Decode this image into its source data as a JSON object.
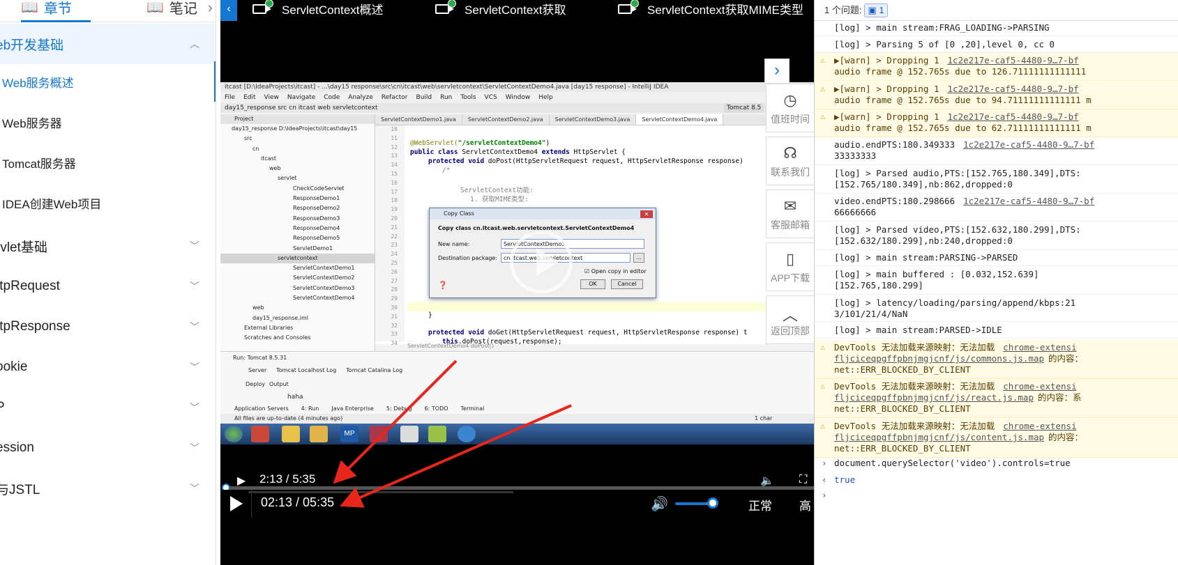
{
  "sidebar": {
    "tab_chapters": "章节",
    "tab_notes": "笔记",
    "chapters": [
      {
        "label": "eb开发基础",
        "active": true
      },
      {
        "label": "rvlet基础"
      },
      {
        "label": "ttpRequest"
      },
      {
        "label": "ttpResponse"
      },
      {
        "label": "ookie"
      },
      {
        "label": "P"
      },
      {
        "label": "ession"
      },
      {
        "label": "与JSTL"
      }
    ],
    "sections": [
      {
        "label": "Web服务概述",
        "active": true
      },
      {
        "label": "Web服务器"
      },
      {
        "label": "Tomcat服务器"
      },
      {
        "label": "IDEA创建Web项目"
      }
    ]
  },
  "video": {
    "titles": [
      "ServletContext概述",
      "ServletContext获取",
      "ServletContext获取MIME类型"
    ],
    "native_time": "2:13 / 5:35",
    "player_time": "02:13 / 05:35",
    "progress": 0.397,
    "volume": 0.75,
    "speed": "正常",
    "quality": "高"
  },
  "side_tools": [
    {
      "label": "值班时间",
      "icon": "clock-icon"
    },
    {
      "label": "联系我们",
      "icon": "headset-icon"
    },
    {
      "label": "客服邮箱",
      "icon": "mail-icon"
    },
    {
      "label": "APP下载",
      "icon": "phone-icon"
    },
    {
      "label": "返回顶部",
      "icon": "chevron-up-icon"
    }
  ],
  "ide": {
    "title": "itcast [D:\\IdeaProjects\\itcast] - ...\\day15 response\\src\\cn\\itcast\\web\\servletcontext\\ServletContextDemo4.java [day15 response] - IntelliJ IDEA",
    "menu": [
      "File",
      "Edit",
      "View",
      "Navigate",
      "Code",
      "Analyze",
      "Refactor",
      "Build",
      "Run",
      "Tools",
      "VCS",
      "Window",
      "Help"
    ],
    "crumb": "day15_response  src  cn  itcast  web  servletcontext",
    "project_label": "Project",
    "tree": [
      "day15_response  D:\\IdeaProjects\\itcast\\day15",
      "src",
      "cn",
      "itcast",
      "web",
      "servlet",
      "CheckCodeServlet",
      "ResponseDemo1",
      "ResponseDemo2",
      "ResponseDemo3",
      "ResponseDemo4",
      "ResponseDemo5",
      "ServletDemo1",
      "servletcontext",
      "ServletContextDemo1",
      "ServletContextDemo2",
      "ServletContextDemo3",
      "ServletContextDemo4",
      "web",
      "day15_response.iml",
      "External Libraries",
      "Scratches and Consoles"
    ],
    "editor_tabs": [
      "ServletContextDemo1.java",
      "ServletContextDemo2.java",
      "ServletContextDemo3.java",
      "ServletContextDemo4.java"
    ],
    "line_numbers": [
      "10",
      "11",
      "12",
      "13",
      "14",
      "15",
      "16",
      "17",
      "18",
      "19",
      "20",
      "21",
      "22",
      "23",
      "24",
      "25",
      "26",
      "27",
      "28",
      "29",
      "30",
      "31",
      "32",
      "33",
      "34"
    ],
    "code": {
      "l1_ann": "@WebServlet(",
      "l1_str": "\"/servletContextDemo4\"",
      "l1_end": ")",
      "l2_kw1": "public class",
      "l2_mid": " ServletContextDemo4 ",
      "l2_kw2": "extends",
      "l2_end": " HttpServlet {",
      "l3_kw": "protected void",
      "l3_end": " doPost(HttpServletRequest request, HttpServletResponse response)",
      "l4": "/*",
      "l5": "ServletContext功能:",
      "l6": "1. 获取MIME类型:",
      "l7": "}",
      "l8_kw": "protected void",
      "l8_end": " doGet(HttpServletRequest request, HttpServletResponse response) t",
      "l9_kw": "this",
      "l9_end": ".doPost(request,response);",
      "footer": "ServletContextDemo4  doPost()"
    },
    "dialog": {
      "title": "Copy Class",
      "heading": "Copy class cn.itcast.web.servletcontext.ServletContextDemo4",
      "new_name_label": "New name:",
      "new_name_value": "ServletContextDemo5",
      "dest_label": "Destination package:",
      "dest_value": "cn.itcast.web.servletcontext",
      "open_copy": "Open copy in editor",
      "ok": "OK",
      "cancel": "Cancel"
    },
    "run_label": "Run:",
    "run_config": "Tomcat 8.5.31",
    "run_tabs": [
      "Server",
      "Tomcat Localhost Log",
      "Tomcat Catalina Log"
    ],
    "deploy_label": "Deploy",
    "output_label": "Output",
    "output_text": "haha",
    "tool_tabs": [
      "Application Servers",
      "4: Run",
      "Java Enterprise",
      "5: Debug",
      "6: TODO",
      "Terminal"
    ],
    "status": "All files are up-to-date (4 minutes ago)",
    "char_count": "1 char",
    "tomcat_tab": "Tomcat 8.5"
  },
  "devtools": {
    "issues_label": "1 个问题:",
    "issues_count": "1",
    "messages": [
      {
        "text": "[log] > main stream:FRAG_LOADING->PARSING",
        "type": "log"
      },
      {
        "text": "[log] > Parsing 5 of [0 ,20],level 0, cc 0",
        "type": "log"
      },
      {
        "text": "▶[warn] > Dropping 1",
        "link": "1c2e217e-caf5-4480-9…7-bf",
        "text2": "audio frame @ 152.765s due to 126.71111111111111",
        "type": "warn"
      },
      {
        "text": "▶[warn] > Dropping 1",
        "link": "1c2e217e-caf5-4480-9…7-bf",
        "text2": "audio frame @ 152.765s due to 94.71111111111111 m",
        "type": "warn"
      },
      {
        "text": "▶[warn] > Dropping 1",
        "link": "1c2e217e-caf5-4480-9…7-bf",
        "text2": "audio frame @ 152.765s due to 62.71111111111111 m",
        "type": "warn"
      },
      {
        "text": "audio.endPTS:180.349333",
        "link": "1c2e217e-caf5-4480-9…7-bf",
        "text2": "33333333",
        "type": "log"
      },
      {
        "text": "[log] > Parsed audio,PTS:[152.765,180.349],DTS:",
        "text2": "[152.765/180.349],nb:862,dropped:0",
        "type": "log"
      },
      {
        "text": "video.endPTS:180.298666",
        "link": "1c2e217e-caf5-4480-9…7-bf",
        "text2": "66666666",
        "type": "log"
      },
      {
        "text": "[log] > Parsed video,PTS:[152.632,180.299],DTS:",
        "text2": "[152.632/180.299],nb:240,dropped:0",
        "type": "log"
      },
      {
        "text": "[log] > main stream:PARSING->PARSED",
        "type": "log"
      },
      {
        "text": "[log] > main buffered : [0.032,152.639]",
        "text2": "[152.765,180.299]",
        "type": "log"
      },
      {
        "text": "[log] > latency/loading/parsing/append/kbps:21",
        "text2": "3/101/21/4/NaN",
        "type": "log"
      },
      {
        "text": "[log] > main stream:PARSED->IDLE",
        "type": "log"
      },
      {
        "text": "DevTools 无法加载来源映射：无法加载",
        "link": "chrome-extensi",
        "text2": "fljciceqpgffpbnjmgjcnf/js/commons.js.map",
        "text2b": "的内容：",
        "text3": "net::ERR_BLOCKED_BY_CLIENT",
        "type": "warn"
      },
      {
        "text": "DevTools 无法加载来源映射：无法加载",
        "link": "chrome-extensi",
        "text2": "fljciceqpgffpbnjmgjcnf/js/react.js.map",
        "text2b": "的内容：系",
        "text3": "net::ERR_BLOCKED_BY_CLIENT",
        "type": "warn"
      },
      {
        "text": "DevTools 无法加载来源映射：无法加载",
        "link": "chrome-extensi",
        "text2": "fljciceqpgffpbnjmgjcnf/js/content.js.map",
        "text2b": "的内容：",
        "text3": "net::ERR_BLOCKED_BY_CLIENT",
        "type": "warn"
      }
    ],
    "input_cmd": "document.querySelector('video').controls=true",
    "result": "true"
  },
  "colors": {
    "accent": "#1677d2",
    "arrow": "#e8261b"
  }
}
